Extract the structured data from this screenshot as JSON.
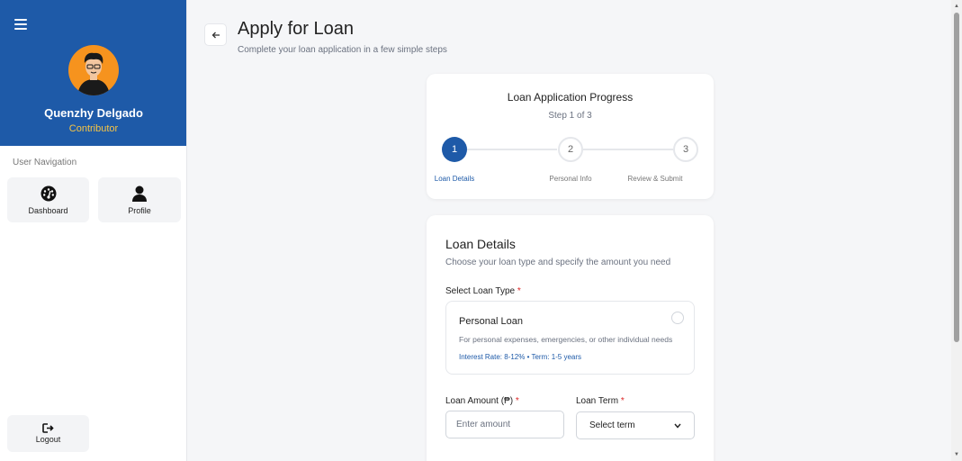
{
  "profile": {
    "name": "Quenzhy Delgado",
    "role": "Contributor"
  },
  "nav": {
    "heading": "User Navigation",
    "dashboard": "Dashboard",
    "profile": "Profile",
    "logout": "Logout"
  },
  "page": {
    "title": "Apply for Loan",
    "subtitle": "Complete your loan application in a few simple steps"
  },
  "progress": {
    "title": "Loan Application Progress",
    "step_text": "Step 1 of 3",
    "steps": [
      {
        "number": "1",
        "label": "Loan Details"
      },
      {
        "number": "2",
        "label": "Personal Info"
      },
      {
        "number": "3",
        "label": "Review & Submit"
      }
    ]
  },
  "details": {
    "title": "Loan Details",
    "subtitle": "Choose your loan type and specify the amount you need",
    "loan_type_label": "Select Loan Type",
    "required_mark": "*",
    "option": {
      "name": "Personal Loan",
      "description": "For personal expenses, emergencies, or other individual needs",
      "rate": "Interest Rate: 8-12% • Term: 1-5 years"
    },
    "amount_label": "Loan Amount (₱)",
    "amount_placeholder": "Enter amount",
    "term_label": "Loan Term",
    "term_selected": "Select term"
  },
  "colors": {
    "primary": "#1e5aa8",
    "avatar_bg": "#f6931e",
    "role": "#f6c445",
    "required": "#dc2626"
  }
}
